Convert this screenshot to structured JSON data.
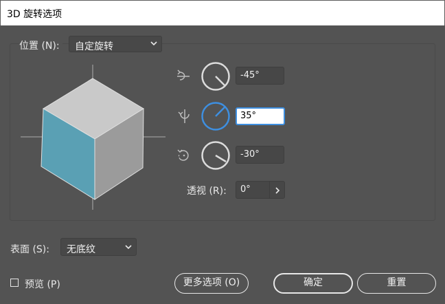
{
  "window": {
    "title": "3D 旋转选项"
  },
  "position": {
    "label": "位置 (N):",
    "value": "自定旋转"
  },
  "rotation": {
    "x": {
      "value": "-45°",
      "angle": -45
    },
    "y": {
      "value": "35°",
      "angle": 35
    },
    "z": {
      "value": "-30°",
      "angle": -30
    }
  },
  "perspective": {
    "label": "透视 (R):",
    "value": "0°"
  },
  "surface": {
    "label": "表面 (S):",
    "value": "无底纹"
  },
  "preview": {
    "label": "预览 (P)",
    "checked": false
  },
  "buttons": {
    "more": "更多选项 (O)",
    "ok": "确定",
    "reset": "重置"
  },
  "colors": {
    "cube_top": "#c9c9c9",
    "cube_left": "#5aa0b4",
    "cube_right": "#9b9b9b",
    "accent": "#3e8fe0"
  }
}
